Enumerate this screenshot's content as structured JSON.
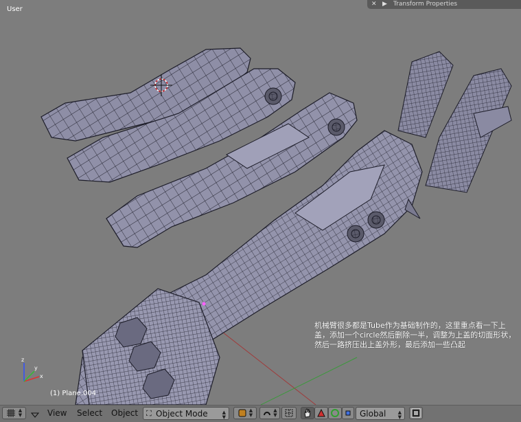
{
  "viewport": {
    "view_label": "User",
    "object_label": "(1) Plane.004",
    "annotation": "机械臂很多都是Tube作为基础制作的，这里重点看一下上盖，添加一个circle然后删除一半，调整为上盖的切面形状，然后一路挤压出上盖外形，最后添加一些凸起"
  },
  "transform_panel": {
    "title": "Transform Properties",
    "close_glyph": "✕",
    "collapse_glyph": "▶"
  },
  "header": {
    "editor_type_icon": "grid-icon",
    "menus": [
      "View",
      "Select",
      "Object"
    ],
    "mode": "Object Mode",
    "orientation": "Global"
  },
  "colors": {
    "viewport_bg": "#7d7d7d",
    "mesh_fill": "#8e8ea6",
    "mesh_wire": "#1c1c28",
    "header_bg": "#727272"
  }
}
